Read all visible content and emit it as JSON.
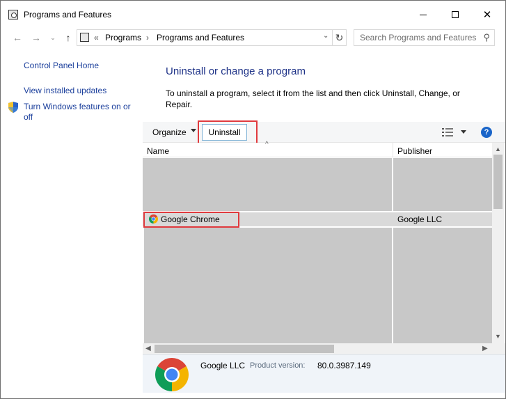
{
  "window": {
    "title": "Programs and Features"
  },
  "address": {
    "prefix": "«",
    "segments": [
      "Programs",
      "Programs and Features"
    ],
    "separator": "›",
    "search_placeholder": "Search Programs and Features"
  },
  "sidebar": {
    "items": [
      {
        "label": "Control Panel Home"
      },
      {
        "label": "View installed updates"
      },
      {
        "label": "Turn Windows features on or off"
      }
    ]
  },
  "main": {
    "title": "Uninstall or change a program",
    "description": "To uninstall a program, select it from the list and then click Uninstall, Change, or Repair."
  },
  "toolbar": {
    "organize_label": "Organize",
    "uninstall_label": "Uninstall",
    "help_label": "?"
  },
  "list": {
    "columns": [
      "Name",
      "Publisher"
    ],
    "rows": [
      {
        "name": "Google Chrome",
        "publisher": "Google LLC",
        "selected": true
      }
    ]
  },
  "details": {
    "publisher": "Google LLC",
    "version_label": "Product version:",
    "version": "80.0.3987.149"
  },
  "colors": {
    "link": "#1a3e9b",
    "title": "#1e3287",
    "highlight": "#e03a3e",
    "selected_row": "#d9d9d9",
    "redacted": "#c8c8c8"
  }
}
